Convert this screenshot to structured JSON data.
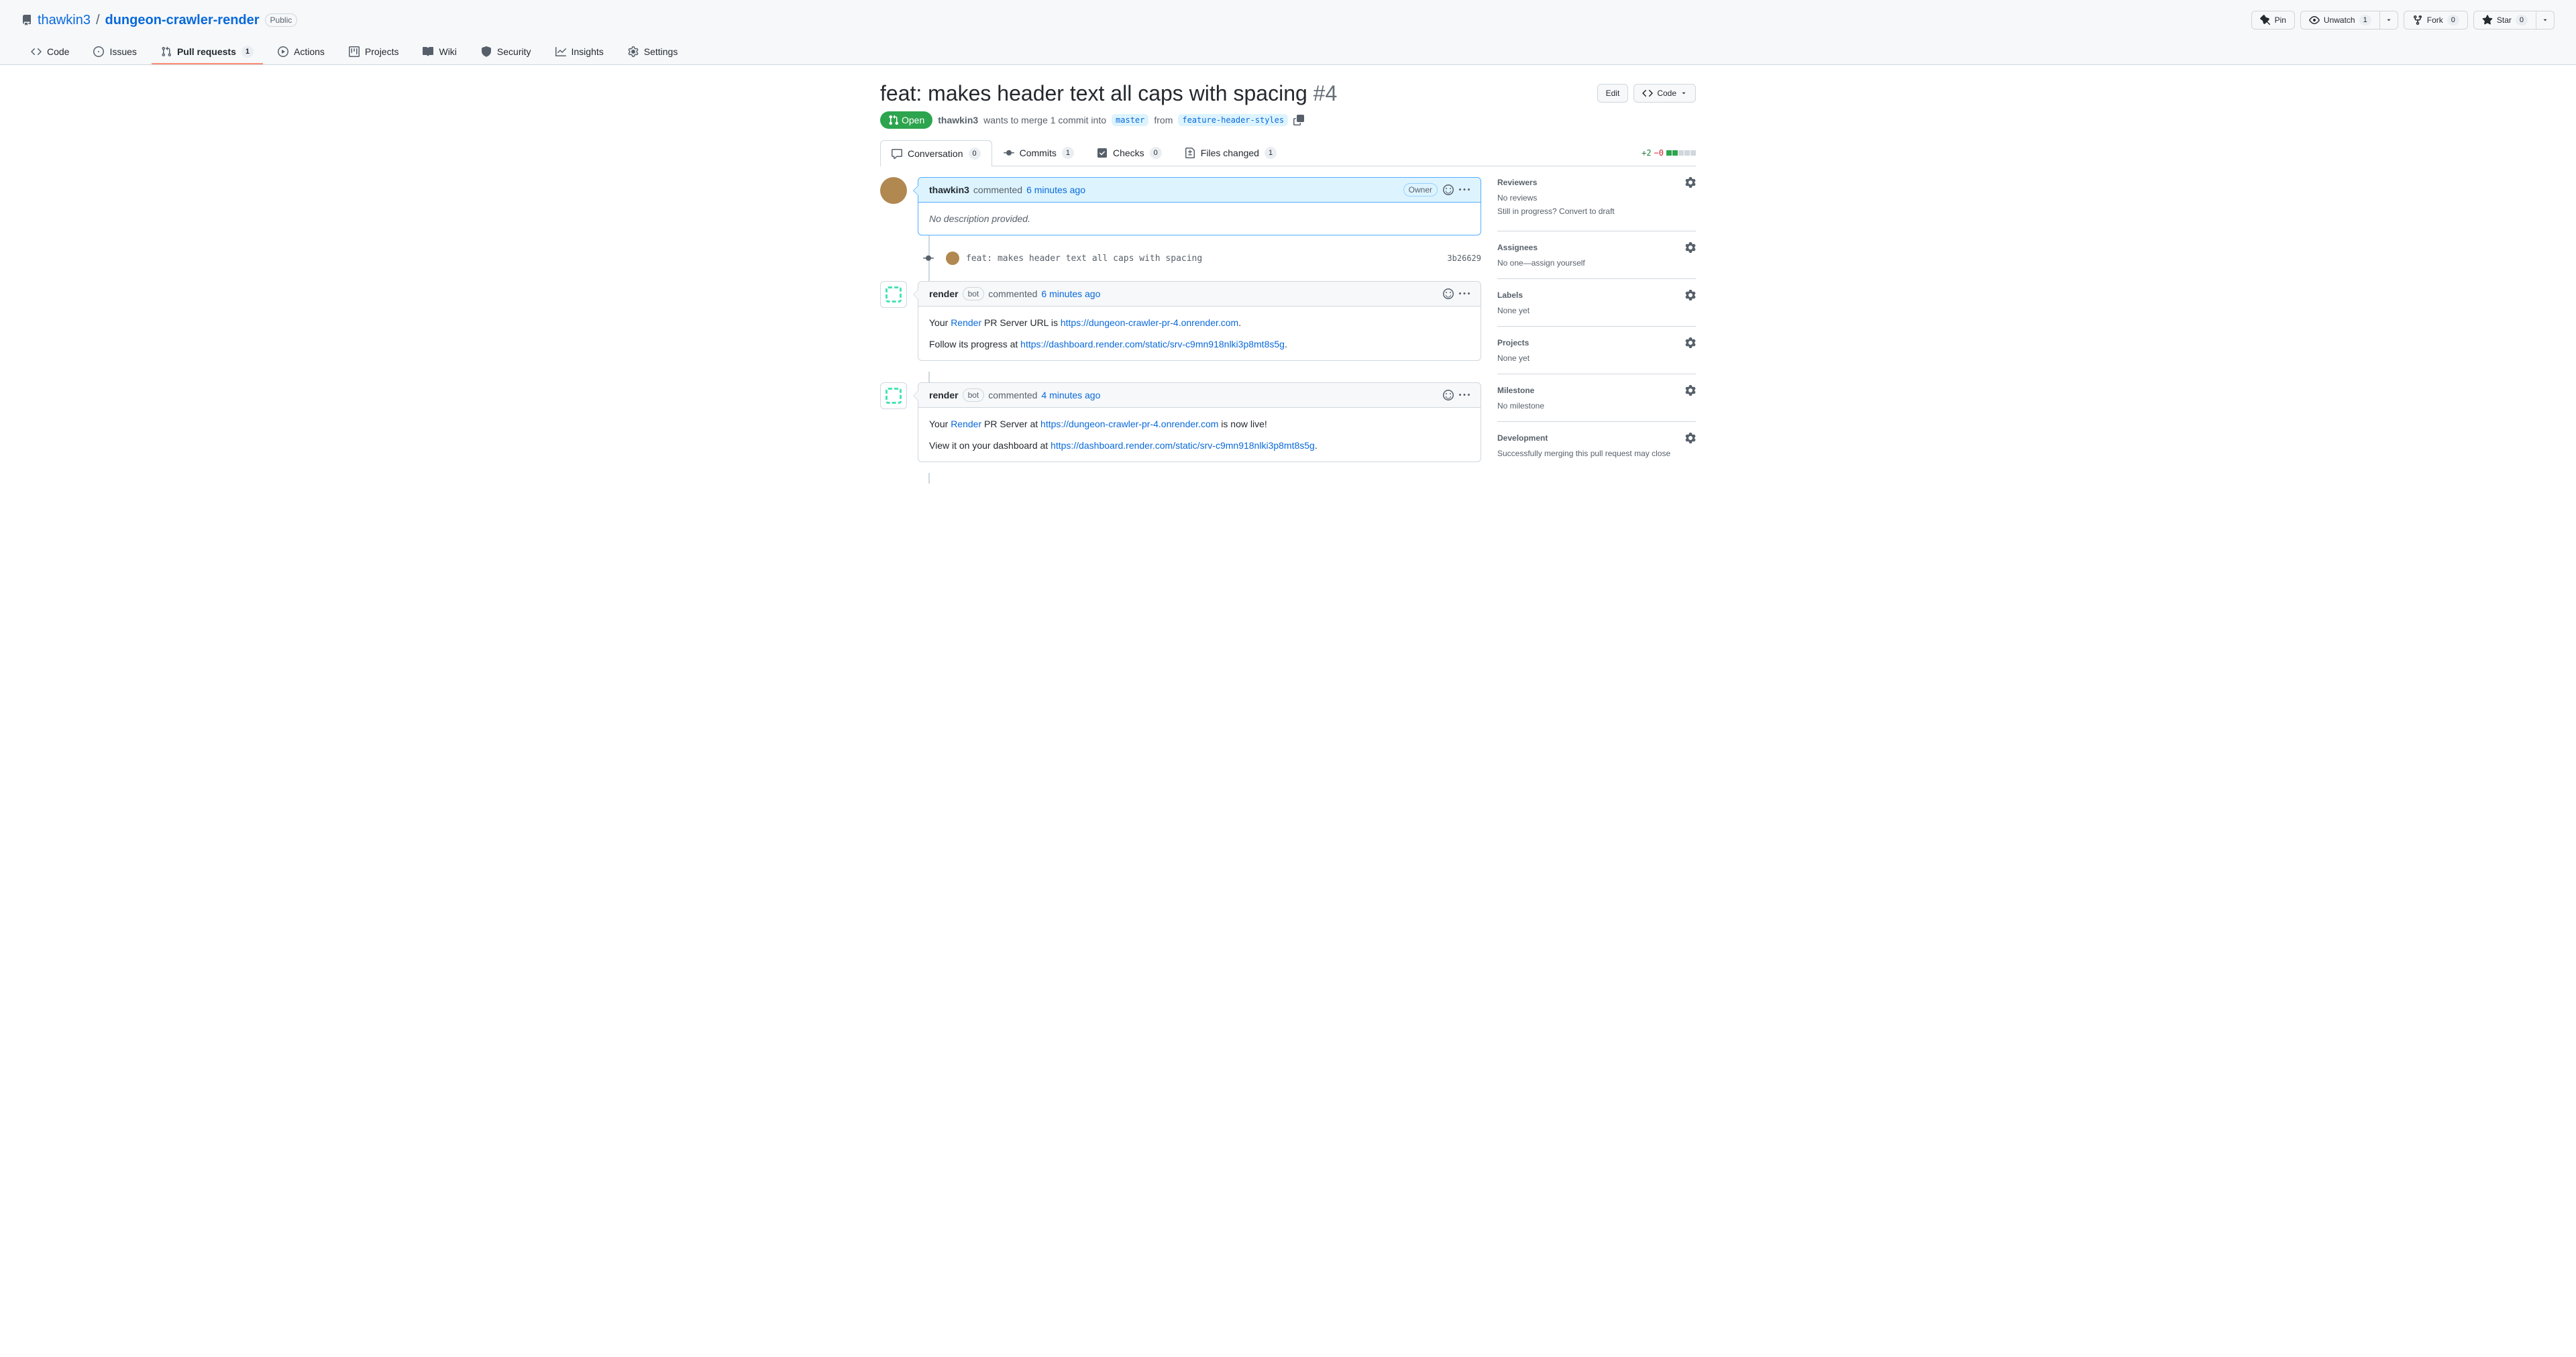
{
  "repo": {
    "owner": "thawkin3",
    "name": "dungeon-crawler-render",
    "visibility": "Public"
  },
  "repoActions": {
    "pin": "Pin",
    "unwatch": "Unwatch",
    "unwatch_count": "1",
    "fork": "Fork",
    "fork_count": "0",
    "star": "Star",
    "star_count": "0"
  },
  "repoNav": {
    "code": "Code",
    "issues": "Issues",
    "pulls": "Pull requests",
    "pulls_count": "1",
    "actions": "Actions",
    "projects": "Projects",
    "wiki": "Wiki",
    "security": "Security",
    "insights": "Insights",
    "settings": "Settings"
  },
  "pr": {
    "title": "feat: makes header text all caps with spacing",
    "number": "#4",
    "state": "Open",
    "author": "thawkin3",
    "merge_text_1": "wants to merge 1 commit into",
    "base_branch": "master",
    "merge_text_2": "from",
    "head_branch": "feature-header-styles",
    "edit_btn": "Edit",
    "code_btn": "Code"
  },
  "prTabs": {
    "conversation": "Conversation",
    "conversation_count": "0",
    "commits": "Commits",
    "commits_count": "1",
    "checks": "Checks",
    "checks_count": "0",
    "files": "Files changed",
    "files_count": "1"
  },
  "diffstat": {
    "add": "+2",
    "del": "−0"
  },
  "timeline": {
    "comment1": {
      "author": "thawkin3",
      "action": "commented",
      "time": "6 minutes ago",
      "badge": "Owner",
      "body": "No description provided."
    },
    "commit1": {
      "message": "feat: makes header text all caps with spacing",
      "sha": "3b26629"
    },
    "comment2": {
      "author": "render",
      "bot_label": "bot",
      "action": "commented",
      "time": "6 minutes ago",
      "body_p1_pre": "Your ",
      "body_p1_link1": "Render",
      "body_p1_mid": " PR Server URL is ",
      "body_p1_link2": "https://dungeon-crawler-pr-4.onrender.com",
      "body_p1_post": ".",
      "body_p2_pre": "Follow its progress at ",
      "body_p2_link": "https://dashboard.render.com/static/srv-c9mn918nlki3p8mt8s5g",
      "body_p2_post": "."
    },
    "comment3": {
      "author": "render",
      "bot_label": "bot",
      "action": "commented",
      "time": "4 minutes ago",
      "body_p1_pre": "Your ",
      "body_p1_link1": "Render",
      "body_p1_mid": " PR Server at ",
      "body_p1_link2": "https://dungeon-crawler-pr-4.onrender.com",
      "body_p1_post": " is now live!",
      "body_p2_pre": "View it on your dashboard at ",
      "body_p2_link": "https://dashboard.render.com/static/srv-c9mn918nlki3p8mt8s5g",
      "body_p2_post": "."
    }
  },
  "sidebar": {
    "reviewers": {
      "title": "Reviewers",
      "body1": "No reviews",
      "body2": "Still in progress? Convert to draft"
    },
    "assignees": {
      "title": "Assignees",
      "body1_pre": "No one—",
      "body1_link": "assign yourself"
    },
    "labels": {
      "title": "Labels",
      "body": "None yet"
    },
    "projects": {
      "title": "Projects",
      "body": "None yet"
    },
    "milestone": {
      "title": "Milestone",
      "body": "No milestone"
    },
    "development": {
      "title": "Development",
      "body": "Successfully merging this pull request may close"
    }
  }
}
